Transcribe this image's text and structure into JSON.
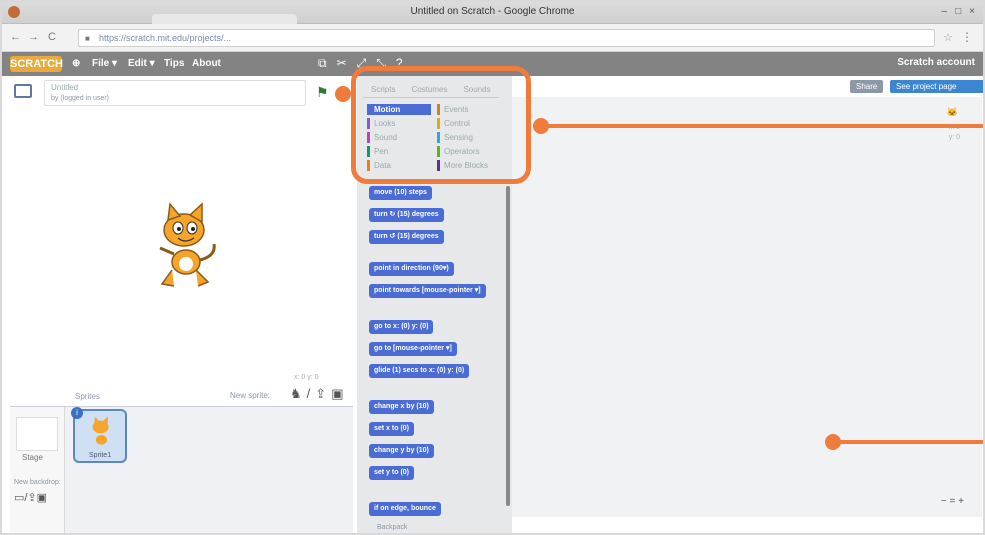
{
  "browser": {
    "window_title": "Untitled on Scratch - Google Chrome",
    "url": "https://scratch.mit.edu/projects/...",
    "window_buttons": [
      "–",
      "□",
      "×"
    ]
  },
  "menubar": {
    "logo": "SCRATCH",
    "items": [
      "File ▾",
      "Edit ▾",
      "Tips",
      "About"
    ],
    "right_label": "Scratch account"
  },
  "stage_header": {
    "project_title": "Untitled",
    "author": "by (logged in user)"
  },
  "stage_footer": {
    "sprites_label": "Sprites",
    "new_sprite_label": "New sprite:",
    "coords": "x: 0  y: 0"
  },
  "sprite_pane": {
    "stage_label": "Stage",
    "backdrop_label": "New backdrop:",
    "sprite_name": "Sprite1"
  },
  "palette": {
    "tabs": [
      "Scripts",
      "Costumes",
      "Sounds"
    ],
    "categories_left": [
      {
        "name": "Motion",
        "color": "#4a6cd4",
        "selected": true
      },
      {
        "name": "Looks",
        "color": "#8a55d7",
        "selected": false
      },
      {
        "name": "Sound",
        "color": "#bb42c3",
        "selected": false
      },
      {
        "name": "Pen",
        "color": "#0e9a6c",
        "selected": false
      },
      {
        "name": "Data",
        "color": "#ee7d16",
        "selected": false
      }
    ],
    "categories_right": [
      {
        "name": "Events",
        "color": "#c88330"
      },
      {
        "name": "Control",
        "color": "#e1a91a"
      },
      {
        "name": "Sensing",
        "color": "#2ca5e2"
      },
      {
        "name": "Operators",
        "color": "#5cb712"
      },
      {
        "name": "More Blocks",
        "color": "#632d99"
      }
    ],
    "blocks": [
      "move (10) steps",
      "turn ↻ (15) degrees",
      "turn ↺ (15) degrees",
      "point in direction (90▾)",
      "point towards [mouse-pointer ▾]",
      "go to x: (0) y: (0)",
      "go to [mouse-pointer ▾]",
      "glide (1) secs to x: (0) y: (0)",
      "change x by (10)",
      "set x to (0)",
      "change y by (10)",
      "set y to (0)",
      "if on edge, bounce"
    ],
    "bottom_label": "Backpack"
  },
  "script_header": {
    "share_label": "Share",
    "see_page_label": "See project page"
  },
  "script_area": {
    "xy_readout": "x: 0\ny: 0",
    "zoom_controls": "− = +"
  },
  "annotation_color": "#ef7b3c"
}
